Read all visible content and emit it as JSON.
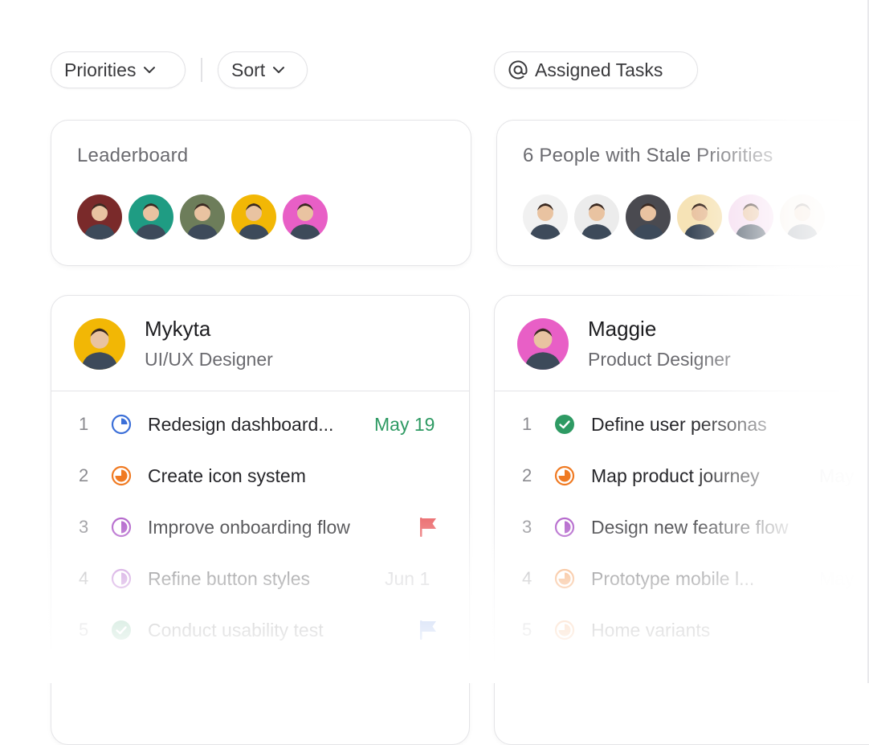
{
  "toolbar": {
    "priorities_label": "Priorities",
    "sort_label": "Sort",
    "assigned_label": "Assigned Tasks"
  },
  "leaderboard": {
    "title": "Leaderboard",
    "avatars": [
      {
        "bg": "#7a2a2a"
      },
      {
        "bg": "#1f9c83"
      },
      {
        "bg": "#6d7d5a"
      },
      {
        "bg": "#f2b705"
      },
      {
        "bg": "#e85fc6"
      }
    ]
  },
  "stale": {
    "title": "6 People with Stale Priorities",
    "avatars": [
      {
        "bg": "#f1f1f1"
      },
      {
        "bg": "#ececec"
      },
      {
        "bg": "#4a4a50"
      },
      {
        "bg": "#f6e3b6"
      },
      {
        "bg": "#f4d9ee"
      },
      {
        "bg": "#f3e8dc"
      }
    ]
  },
  "people": [
    {
      "name": "Mykyta",
      "role": "UI/UX Designer",
      "avatar_bg": "#f2b705",
      "tasks": [
        {
          "num": "1",
          "label": "Redesign dashboard...",
          "due": "May 19",
          "status": "in-progress-quarter",
          "color": "#3b6fd8",
          "due_color": "#2e9a63"
        },
        {
          "num": "2",
          "label": "Create icon system",
          "due": "",
          "status": "in-progress-three-quarter",
          "color": "#f07a22"
        },
        {
          "num": "3",
          "label": "Improve onboarding flow",
          "due": "",
          "status": "in-progress-half",
          "color": "#a64bc3",
          "flag_color": "#e8575a"
        },
        {
          "num": "4",
          "label": "Refine button styles",
          "due": "Jun 1",
          "status": "in-progress-half",
          "color": "#a64bc3",
          "due_color": "#b5b5ba"
        },
        {
          "num": "5",
          "label": "Conduct usability test",
          "due": "",
          "status": "done",
          "color": "#2e9a63",
          "flag_color": "#3b6fd8"
        }
      ]
    },
    {
      "name": "Maggie",
      "role": "Product Designer",
      "avatar_bg": "#e85fc6",
      "tasks": [
        {
          "num": "1",
          "label": "Define user personas",
          "due": "",
          "status": "done",
          "color": "#2e9a63"
        },
        {
          "num": "2",
          "label": "Map product journey",
          "due": "May",
          "status": "in-progress-three-quarter",
          "color": "#f07a22",
          "due_color": "#c9c9cd"
        },
        {
          "num": "3",
          "label": "Design new feature flow",
          "due": "",
          "status": "in-progress-half",
          "color": "#a64bc3"
        },
        {
          "num": "4",
          "label": "Prototype mobile l...",
          "due": "May",
          "status": "in-progress-three-quarter",
          "color": "#f07a22",
          "due_color": "#c9c9cd"
        },
        {
          "num": "5",
          "label": "Home variants",
          "due": "",
          "status": "in-progress-three-quarter",
          "color": "#f07a22"
        }
      ]
    }
  ]
}
